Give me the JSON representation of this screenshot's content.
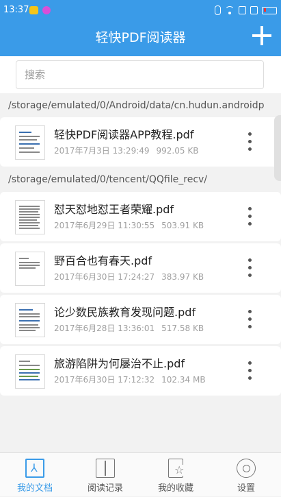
{
  "status_bar": {
    "time": "13:37"
  },
  "header": {
    "title": "轻快PDF阅读器"
  },
  "search": {
    "placeholder": "搜索"
  },
  "groups": [
    {
      "path": "/storage/emulated/0/Android/data/cn.hudun.androidp",
      "files": [
        {
          "name": "轻快PDF阅读器APP教程.pdf",
          "date": "2017年7月3日 13:29:49",
          "size": "992.05 KB"
        }
      ]
    },
    {
      "path": "/storage/emulated/0/tencent/QQfile_recv/",
      "files": [
        {
          "name": "怼天怼地怼王者荣耀.pdf",
          "date": "2017年6月29日 11:30:55",
          "size": "503.91 KB"
        },
        {
          "name": "野百合也有春天.pdf",
          "date": "2017年6月30日 17:24:27",
          "size": "383.97 KB"
        },
        {
          "name": "论少数民族教育发现问题.pdf",
          "date": "2017年6月28日 13:36:01",
          "size": "517.58 KB"
        },
        {
          "name": "旅游陷阱为何屡治不止.pdf",
          "date": "2017年6月30日 17:12:32",
          "size": "102.34 MB"
        }
      ]
    }
  ],
  "tabs": [
    {
      "label": "我的文档",
      "icon": "document-icon",
      "active": true
    },
    {
      "label": "阅读记录",
      "icon": "book-icon",
      "active": false
    },
    {
      "label": "我的收藏",
      "icon": "favorite-icon",
      "active": false
    },
    {
      "label": "设置",
      "icon": "gear-icon",
      "active": false
    }
  ],
  "colors": {
    "accent": "#3a9be8",
    "background": "#f2f2f2"
  }
}
